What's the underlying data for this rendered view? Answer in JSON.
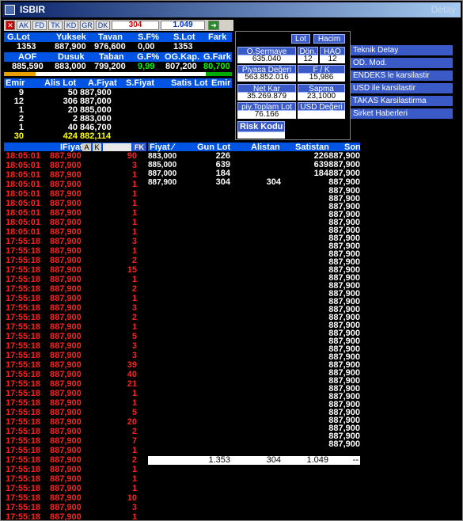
{
  "window": {
    "title": "ISBIR",
    "subtitle": "Detay"
  },
  "toolbar": {
    "buttons": [
      "AK",
      "FD",
      "TK",
      "KD",
      "GR",
      "DK"
    ],
    "value_red": "304",
    "value_blue": "1.049"
  },
  "summary_headers1": [
    "G.Lot",
    "Yuksek",
    "Tavan",
    "S.F%",
    "S.Lot",
    "Fark"
  ],
  "summary_values1": [
    "1353",
    "887,900",
    "976,600",
    "0,00",
    "1353",
    ""
  ],
  "summary_headers2": [
    "AOF",
    "Dusuk",
    "Taban",
    "G.F%",
    "OG.Kap.",
    "G.Fark"
  ],
  "summary_values2": [
    "885,590",
    "883,000",
    "799,200",
    "9,99",
    "807,200",
    "80,700"
  ],
  "depth_headers": [
    "Emir",
    "Alis Lot",
    "A.Fiyat",
    "S.Fiyat",
    "Satis Lot",
    "Emir"
  ],
  "depth_rows": [
    {
      "emir": "9",
      "lot": "50",
      "fiyat": "887,900"
    },
    {
      "emir": "12",
      "lot": "306",
      "fiyat": "887,000"
    },
    {
      "emir": "1",
      "lot": "20",
      "fiyat": "885,000"
    },
    {
      "emir": "2",
      "lot": "2",
      "fiyat": "883,000"
    },
    {
      "emir": "1",
      "lot": "40",
      "fiyat": "846,700"
    }
  ],
  "depth_total": {
    "emir": "30",
    "lot": "424",
    "fiyat": "882,114"
  },
  "panel": {
    "btn_lot": "Lot",
    "btn_hacim": "Hacim",
    "osermaye_label": "O.Sermaye",
    "osermaye": "635.040",
    "don_label": "Dön.",
    "don": "12",
    "hao_label": "HAO",
    "hao": "12",
    "piyasa_label": "Piyasa Değeri",
    "piyasa": "563.852.016",
    "fk_label": "F / K",
    "fk": "15,986",
    "netkar_label": "Net Kar",
    "netkar": "35.269.879",
    "sapma_label": "Sapma",
    "sapma": "23,1000",
    "toplam_label": "piy.Toplam Lot",
    "toplam": "76.166",
    "usd_label": "USD Değeri",
    "risk_label": "Risk Kodu"
  },
  "menu": [
    "Teknik Detay",
    "OD. Mod.",
    "ENDEKS le karsilastir",
    "USD ile karsilastir",
    "TAKAS Karsilastirma",
    "Sirket Haberleri"
  ],
  "trades_header": {
    "fiyat": "IFiyat",
    "btn_a": "A",
    "btn_k": "K",
    "btn_fk": "FK"
  },
  "trades": [
    {
      "t": "18:05:01",
      "p": "887,900",
      "q": "90"
    },
    {
      "t": "18:05:01",
      "p": "887,900",
      "q": "3"
    },
    {
      "t": "18:05:01",
      "p": "887,900",
      "q": "1"
    },
    {
      "t": "18:05:01",
      "p": "887,900",
      "q": "1"
    },
    {
      "t": "18:05:01",
      "p": "887,900",
      "q": "1"
    },
    {
      "t": "18:05:01",
      "p": "887,900",
      "q": "1"
    },
    {
      "t": "18:05:01",
      "p": "887,900",
      "q": "1"
    },
    {
      "t": "18:05:01",
      "p": "887,900",
      "q": "1"
    },
    {
      "t": "18:05:01",
      "p": "887,900",
      "q": "1"
    },
    {
      "t": "17:55:18",
      "p": "887,900",
      "q": "3"
    },
    {
      "t": "17:55:18",
      "p": "887,900",
      "q": "1"
    },
    {
      "t": "17:55:18",
      "p": "887,900",
      "q": "2"
    },
    {
      "t": "17:55:18",
      "p": "887,900",
      "q": "15"
    },
    {
      "t": "17:55:18",
      "p": "887,900",
      "q": "1"
    },
    {
      "t": "17:55:18",
      "p": "887,900",
      "q": "2"
    },
    {
      "t": "17:55:18",
      "p": "887,900",
      "q": "1"
    },
    {
      "t": "17:55:18",
      "p": "887,900",
      "q": "3"
    },
    {
      "t": "17:55:18",
      "p": "887,900",
      "q": "2"
    },
    {
      "t": "17:55:18",
      "p": "887,900",
      "q": "1"
    },
    {
      "t": "17:55:18",
      "p": "887,900",
      "q": "5"
    },
    {
      "t": "17:55:18",
      "p": "887,900",
      "q": "3"
    },
    {
      "t": "17:55:18",
      "p": "887,900",
      "q": "3"
    },
    {
      "t": "17:55:18",
      "p": "887,900",
      "q": "39"
    },
    {
      "t": "17:55:18",
      "p": "887,900",
      "q": "40"
    },
    {
      "t": "17:55:18",
      "p": "887,900",
      "q": "21"
    },
    {
      "t": "17:55:18",
      "p": "887,900",
      "q": "1"
    },
    {
      "t": "17:55:18",
      "p": "887,900",
      "q": "1"
    },
    {
      "t": "17:55:18",
      "p": "887,900",
      "q": "5"
    },
    {
      "t": "17:55:18",
      "p": "887,900",
      "q": "20"
    },
    {
      "t": "17:55:18",
      "p": "887,900",
      "q": "2"
    },
    {
      "t": "17:55:18",
      "p": "887,900",
      "q": "7"
    },
    {
      "t": "17:55:18",
      "p": "887,900",
      "q": "1"
    },
    {
      "t": "17:55:18",
      "p": "887,900",
      "q": "2"
    },
    {
      "t": "17:55:18",
      "p": "887,900",
      "q": "1"
    },
    {
      "t": "17:55:18",
      "p": "887,900",
      "q": "1"
    },
    {
      "t": "17:55:18",
      "p": "887,900",
      "q": "1"
    },
    {
      "t": "17:55:18",
      "p": "887,900",
      "q": "10"
    },
    {
      "t": "17:55:18",
      "p": "887,900",
      "q": "3"
    },
    {
      "t": "17:55:18",
      "p": "887,900",
      "q": "1"
    }
  ],
  "book_headers": [
    "Fiyat",
    "Gun Lot",
    "Alistan",
    "Satistan",
    "Son"
  ],
  "book_rows": [
    {
      "fiyat": "883,000",
      "gun": "226",
      "alis": "",
      "satis": "226",
      "son": "887,900"
    },
    {
      "fiyat": "885,000",
      "gun": "639",
      "alis": "",
      "satis": "639",
      "son": "887,900"
    },
    {
      "fiyat": "887,000",
      "gun": "184",
      "alis": "",
      "satis": "184",
      "son": "887,900"
    },
    {
      "fiyat": "887,900",
      "gun": "304",
      "alis": "304",
      "satis": "",
      "son": "887,900"
    }
  ],
  "son_column": [
    "887,900",
    "887,900",
    "887,900",
    "887,900",
    "887,900",
    "887,900",
    "887,900",
    "887,900",
    "887,900",
    "887,900",
    "887,900",
    "887,900",
    "887,900",
    "887,900",
    "887,900",
    "887,900",
    "887,900",
    "887,900",
    "887,900",
    "887,900",
    "887,900",
    "887,900",
    "887,900",
    "887,900",
    "887,900",
    "887,900",
    "887,900",
    "887,900",
    "887,900",
    "887,900",
    "887,900",
    "887,900",
    "887,900"
  ],
  "totals": {
    "gun": "1.353",
    "alis": "304",
    "satis": "1.049",
    "son": "--"
  }
}
